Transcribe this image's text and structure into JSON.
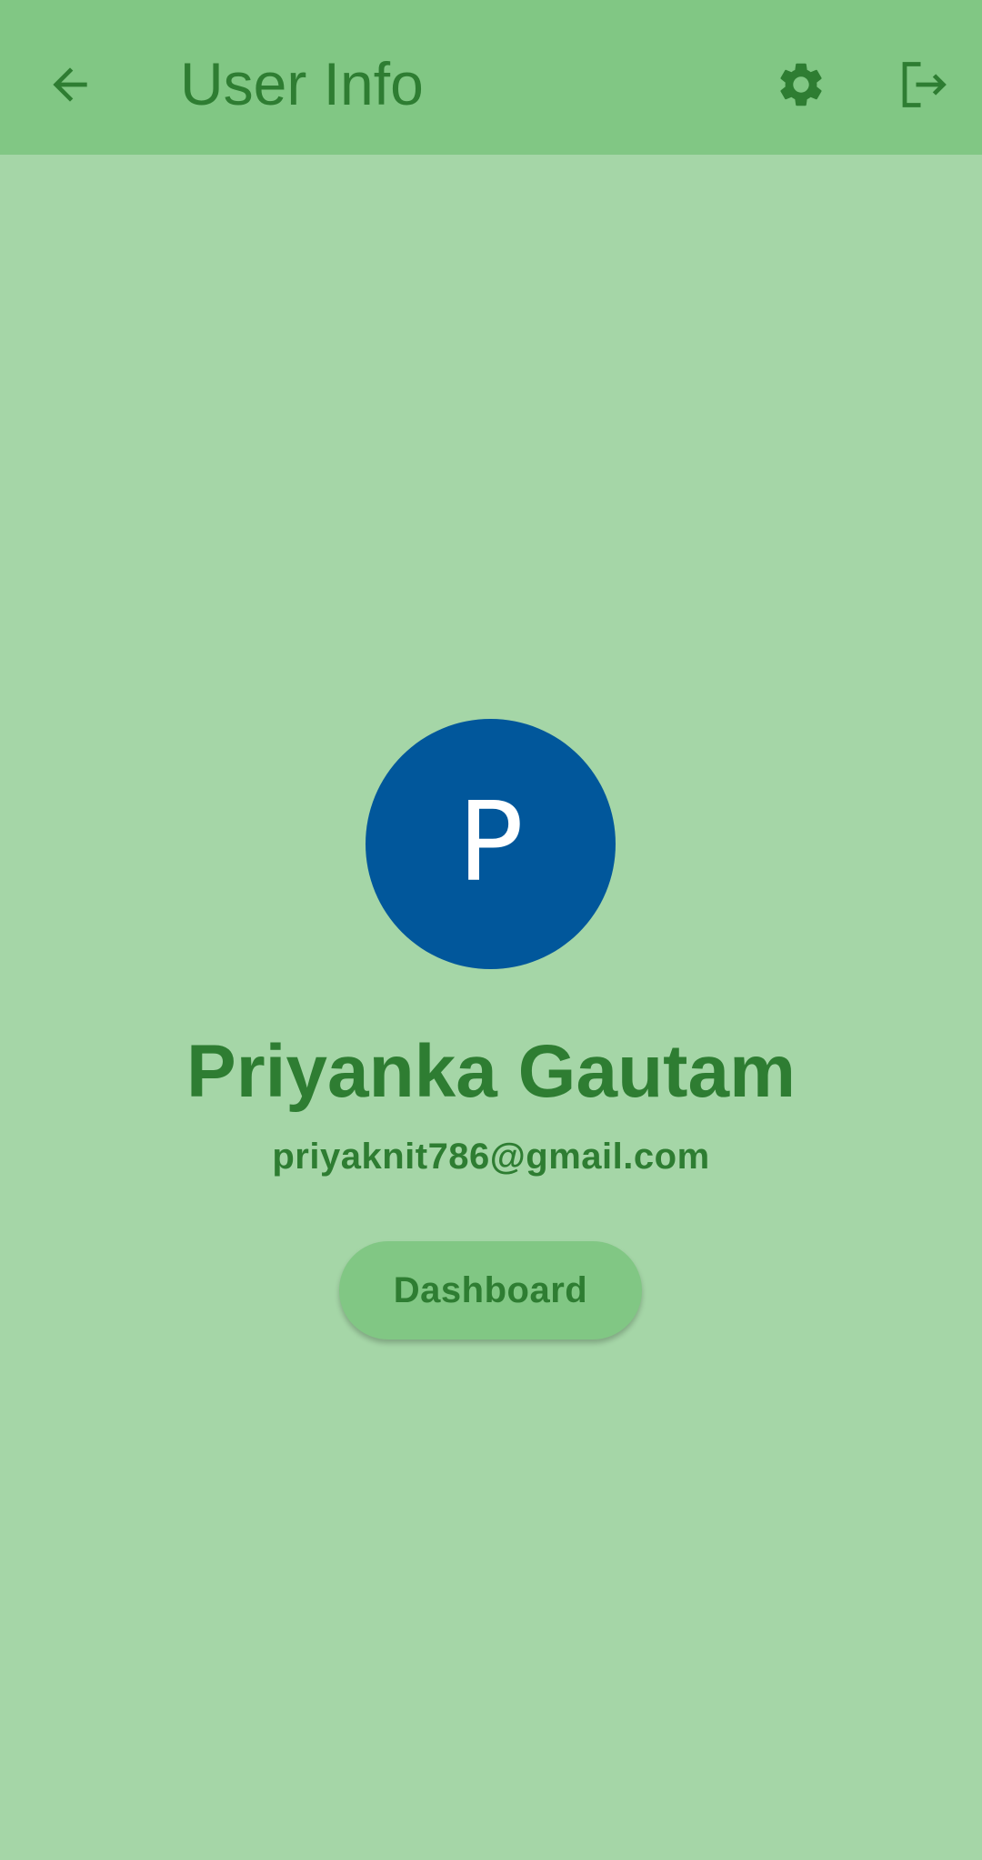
{
  "colors": {
    "background": "#a5d6a7",
    "app_bar": "#81c784",
    "accent_text": "#2e7d32",
    "avatar_bg": "#01579b",
    "avatar_text": "#ffffff"
  },
  "app_bar": {
    "title": "User Info",
    "back_icon": "arrow-left-icon",
    "settings_icon": "gear-icon",
    "logout_icon": "logout-icon"
  },
  "profile": {
    "avatar_initial": "P",
    "name": "Priyanka Gautam",
    "email": "priyaknit786@gmail.com"
  },
  "actions": {
    "dashboard_label": "Dashboard"
  }
}
